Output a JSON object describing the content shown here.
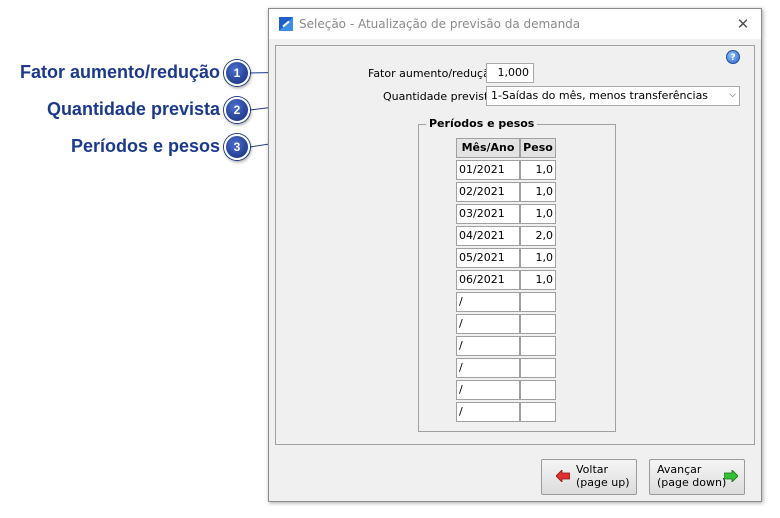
{
  "callouts": [
    {
      "number": "1",
      "label": "Fator aumento/redução"
    },
    {
      "number": "2",
      "label": "Quantidade prevista"
    },
    {
      "number": "3",
      "label": "Períodos e pesos"
    }
  ],
  "window": {
    "title": "Seleção - Atualização de previsão da demanda",
    "close_glyph": "✕",
    "help_glyph": "?"
  },
  "form": {
    "fator_label": "Fator aumento/redução",
    "fator_value": "1,000",
    "quantidade_label": "Quantidade prevista",
    "quantidade_value": "1-Saídas do mês, menos transferências"
  },
  "group": {
    "title": "Períodos e pesos",
    "col_period": "Mês/Ano",
    "col_weight": "Peso",
    "rows": [
      {
        "period": "01/2021",
        "weight": "1,0"
      },
      {
        "period": "02/2021",
        "weight": "1,0"
      },
      {
        "period": "03/2021",
        "weight": "1,0"
      },
      {
        "period": "04/2021",
        "weight": "2,0"
      },
      {
        "period": "05/2021",
        "weight": "1,0"
      },
      {
        "period": "06/2021",
        "weight": "1,0"
      },
      {
        "period": " /",
        "weight": ""
      },
      {
        "period": " /",
        "weight": ""
      },
      {
        "period": " /",
        "weight": ""
      },
      {
        "period": " /",
        "weight": ""
      },
      {
        "period": " /",
        "weight": ""
      },
      {
        "period": " /",
        "weight": ""
      }
    ]
  },
  "buttons": {
    "back_line1": "Voltar",
    "back_line2": "(page up)",
    "next_line1": "Avançar",
    "next_line2": "(page down)"
  }
}
